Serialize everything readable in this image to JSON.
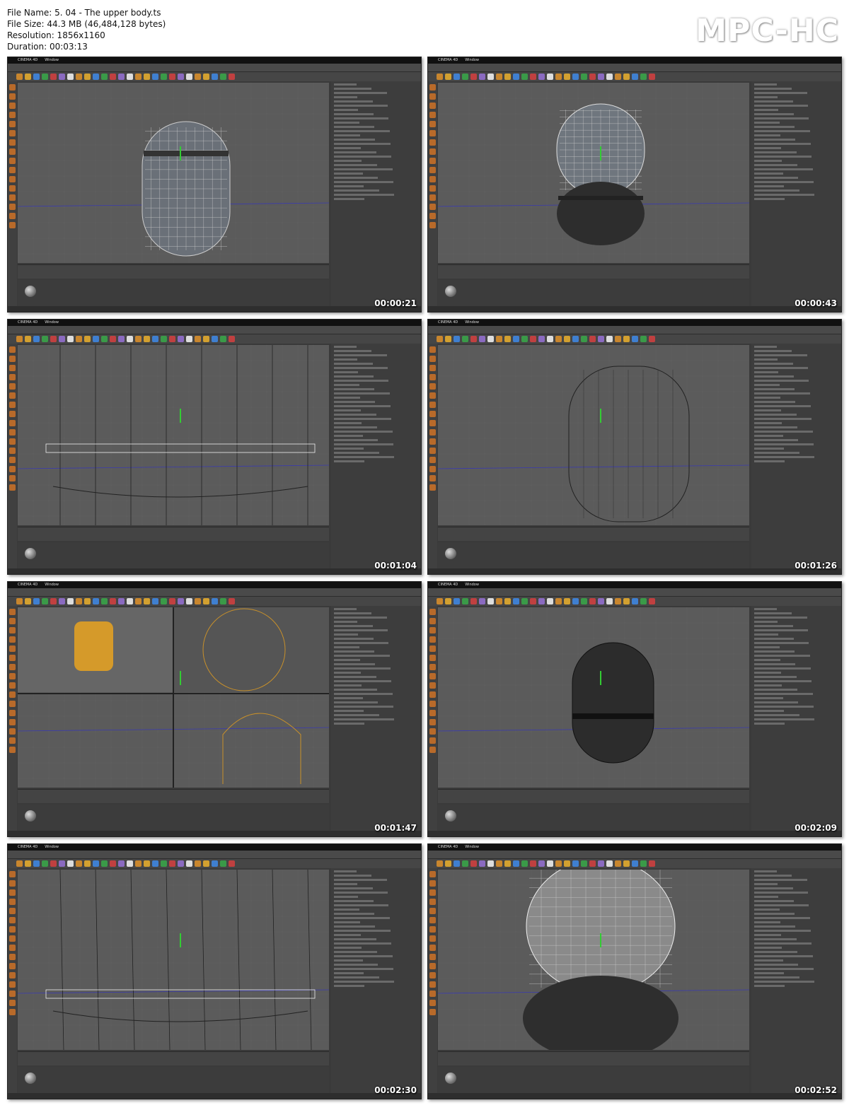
{
  "file_info": {
    "file_name": "File Name: 5. 04 - The upper body.ts",
    "file_size": "File Size: 44.3 MB (46,484,128 bytes)",
    "resolution": "Resolution: 1856x1160",
    "duration": "Duration: 00:03:13"
  },
  "logo": "MPC-HC",
  "app": {
    "title": "CINEMA 4D",
    "menu": "Window"
  },
  "thumbnails": [
    {
      "timestamp": "00:00:21"
    },
    {
      "timestamp": "00:00:43"
    },
    {
      "timestamp": "00:01:04"
    },
    {
      "timestamp": "00:01:26"
    },
    {
      "timestamp": "00:01:47"
    },
    {
      "timestamp": "00:02:09"
    },
    {
      "timestamp": "00:02:30"
    },
    {
      "timestamp": "00:02:52"
    }
  ]
}
